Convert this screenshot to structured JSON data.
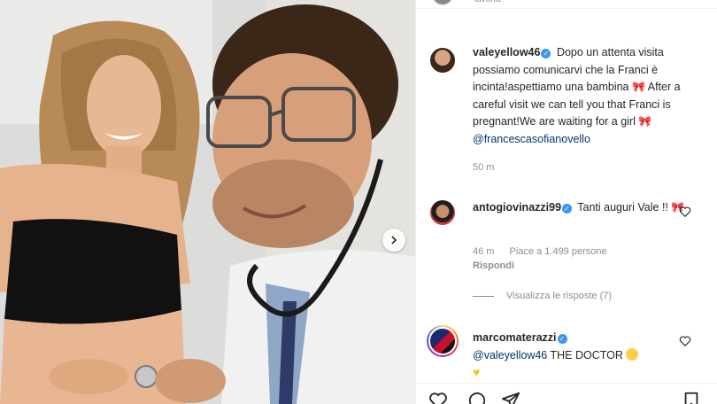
{
  "top_cut_text": "lavoria",
  "caption": {
    "username": "valeyellow46",
    "text_it": "Dopo un attenta visita possiamo comunicarvi che la Franci è incinta!aspettiamo una bambina",
    "text_en": "After a careful visit we can tell you that Franci is pregnant!We are waiting for a girl",
    "mention": "@francescasofianovello",
    "emoji": "bow-emoji",
    "time": "50 m"
  },
  "comments": [
    {
      "username": "antogiovinazzi99",
      "text": "Tanti auguri Vale !!",
      "emoji": "bow-emoji",
      "time": "46 m",
      "likes": "Piace a 1.499 persone",
      "reply": "Rispondi",
      "view_replies": "Visualizza le risposte (7)"
    },
    {
      "username": "marcomaterazzi",
      "mention": "@valeyellow46",
      "text": "THE DOCTOR",
      "emoji": "laughing-emoji, yellow-heart-emoji"
    }
  ],
  "icons": [
    "verified-icon",
    "heart-icon",
    "comment-icon",
    "share-icon",
    "bookmark-icon",
    "chevron-right-icon"
  ],
  "colors": {
    "link": "#00376b",
    "secondary": "#8e8e8e",
    "verified": "#3897f0"
  }
}
